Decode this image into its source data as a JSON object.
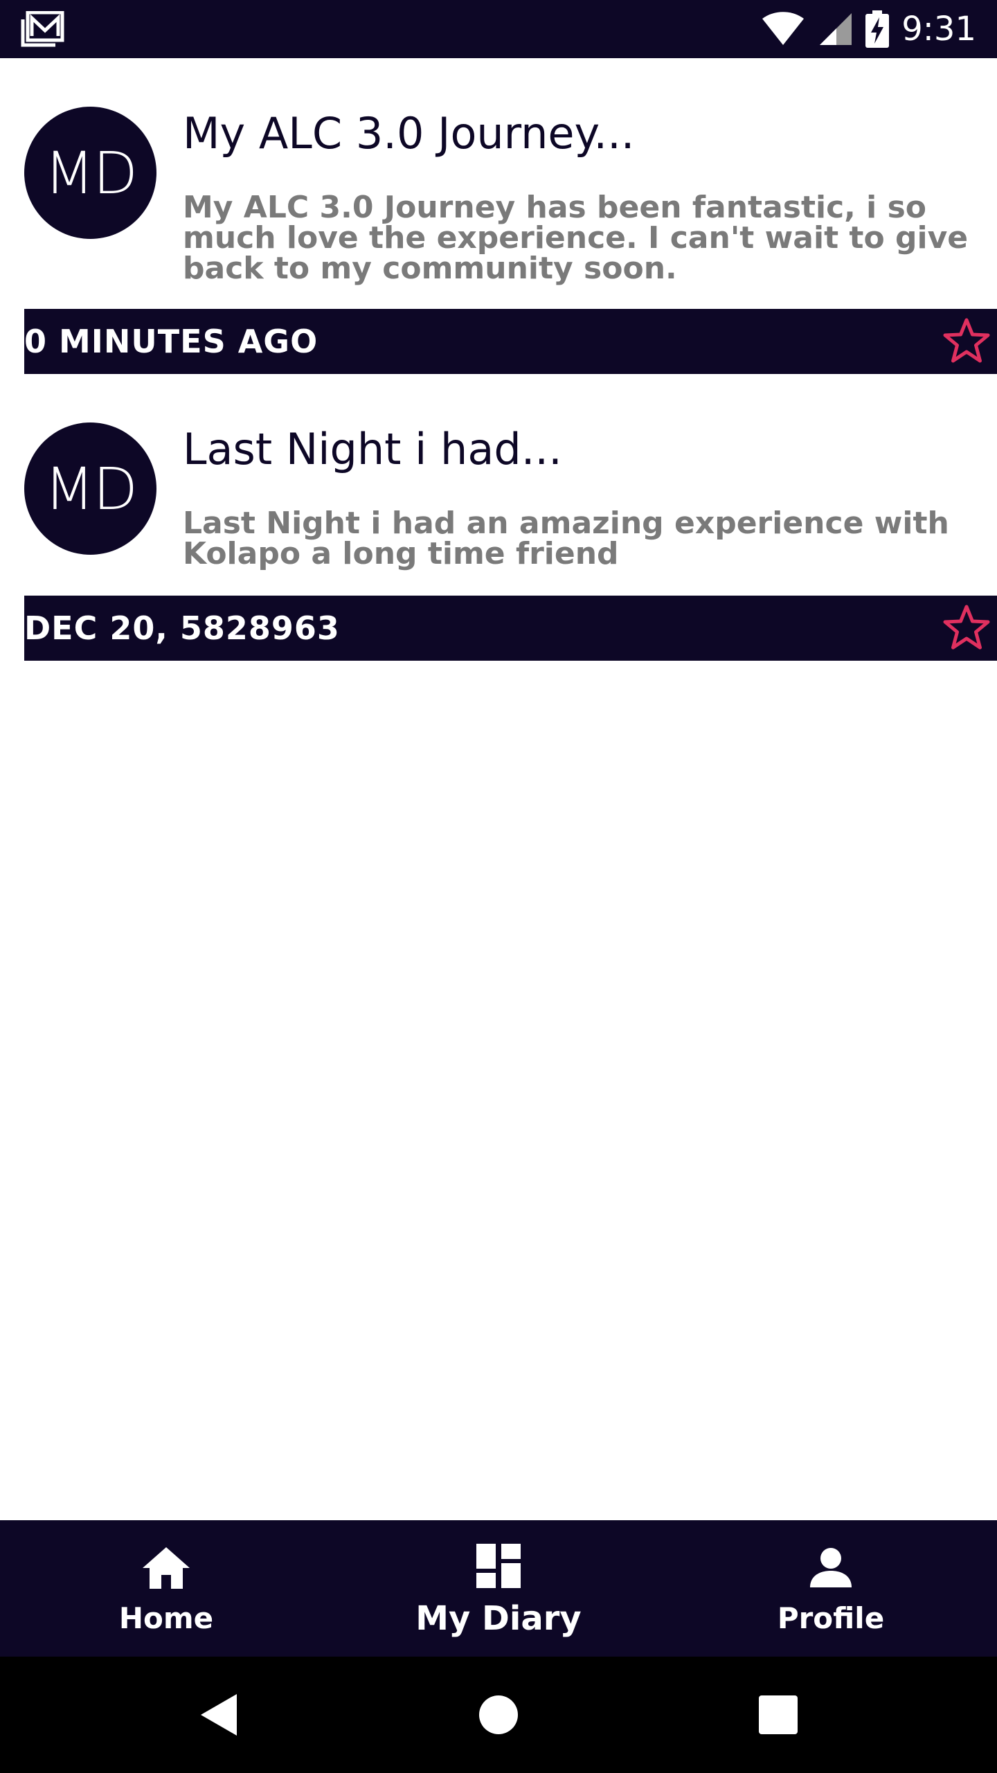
{
  "status_bar": {
    "time": "9:31",
    "left_icon": "gallery-icon",
    "icons": [
      "wifi-icon",
      "signal-icon",
      "battery-charging-icon"
    ]
  },
  "entries": [
    {
      "avatar_initials": "MD",
      "title": "My ALC 3.0 Journey...",
      "body": "My ALC 3.0 Journey has been fantastic, i so much love the experience. I can't wait  to give back to my community soon.",
      "date": "0 MINUTES AGO",
      "star_icon": "star-outline-icon"
    },
    {
      "avatar_initials": "MD",
      "title": "Last Night i had...",
      "body": "Last Night i had an amazing experience with Kolapo a long time friend",
      "date": "DEC 20, 5828963",
      "star_icon": "star-outline-icon"
    }
  ],
  "bottom_nav": {
    "items": [
      {
        "label": "Home",
        "icon": "home-icon"
      },
      {
        "label": "My Diary",
        "icon": "dashboard-icon",
        "active": true
      },
      {
        "label": "Profile",
        "icon": "person-icon"
      }
    ]
  },
  "system_nav": {
    "buttons": [
      "back-icon",
      "home-circle-icon",
      "recents-icon"
    ]
  },
  "colors": {
    "primary": "#0d0726",
    "accent": "#e0305f",
    "body_text": "#7a7a7a"
  }
}
